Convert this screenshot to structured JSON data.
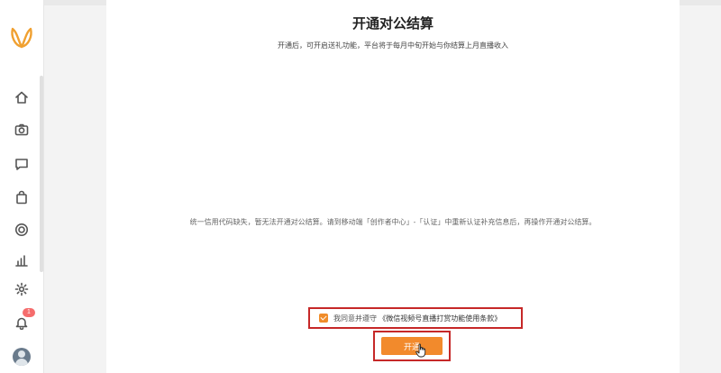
{
  "title": "开通对公结算",
  "subtitle": "开通后，可开启送礼功能，平台将于每月中旬开始与你结算上月直播收入",
  "notice": "统一信用代码缺失，暂无法开通对公结算。请到移动端「创作者中心」-「认证」中重新认证补充信息后，再操作开通对公结算。",
  "agreement": {
    "checked": true,
    "text": "我同意并遵守",
    "link": "《微信视频号直播打赏功能使用条款》"
  },
  "open_button_label": "开通",
  "notification_count": "1",
  "sidebar": {
    "icons": [
      "home-icon",
      "camera-icon",
      "message-icon",
      "bag-icon",
      "target-icon",
      "chart-icon",
      "gear-icon"
    ]
  },
  "colors": {
    "accent": "#f28a2c",
    "highlight_box": "#c62828",
    "logo": "#f0a030",
    "badge": "#f56c6c"
  }
}
